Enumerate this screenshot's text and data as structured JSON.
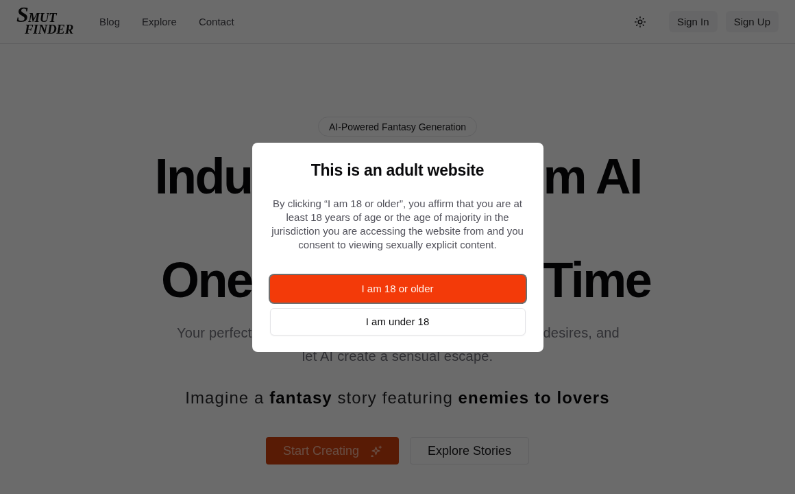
{
  "nav": {
    "logo": {
      "top": "SMUT",
      "bottom": "FINDER"
    },
    "links": [
      "Blog",
      "Explore",
      "Contact"
    ],
    "auth_buttons": [
      "Sign In",
      "Sign Up"
    ]
  },
  "hero": {
    "tag": "AI-Powered Fantasy Generation",
    "heading": [
      {
        "left": "Indu",
        "right": "m AI"
      },
      {
        "left": "One",
        "right": "Time"
      }
    ],
    "subtitle": {
      "line_1": {
        "left": "Your perfect",
        "right": "desires, and"
      },
      "line_2": "let AI create a sensual escape."
    },
    "prompt": "Imagine a **fantasy** story featuring **enemies to lovers**",
    "buttons": [
      {
        "label": "Start Creating",
        "kind": "primary"
      },
      {
        "label": "Explore Stories",
        "kind": "secondary"
      }
    ]
  },
  "modal": {
    "title": "This is an adult website",
    "text": "By clicking “I am 18 or older”, you affirm that you are at least 18 years of age or the age of majority in the jurisdiction you are accessing the website from and you consent to viewing sexually explicit content.",
    "buttons": [
      {
        "label": "I am 18 or older",
        "kind": "primary",
        "focused": true
      },
      {
        "label": "I am under 18",
        "kind": "secondary",
        "focused": false
      }
    ]
  }
}
